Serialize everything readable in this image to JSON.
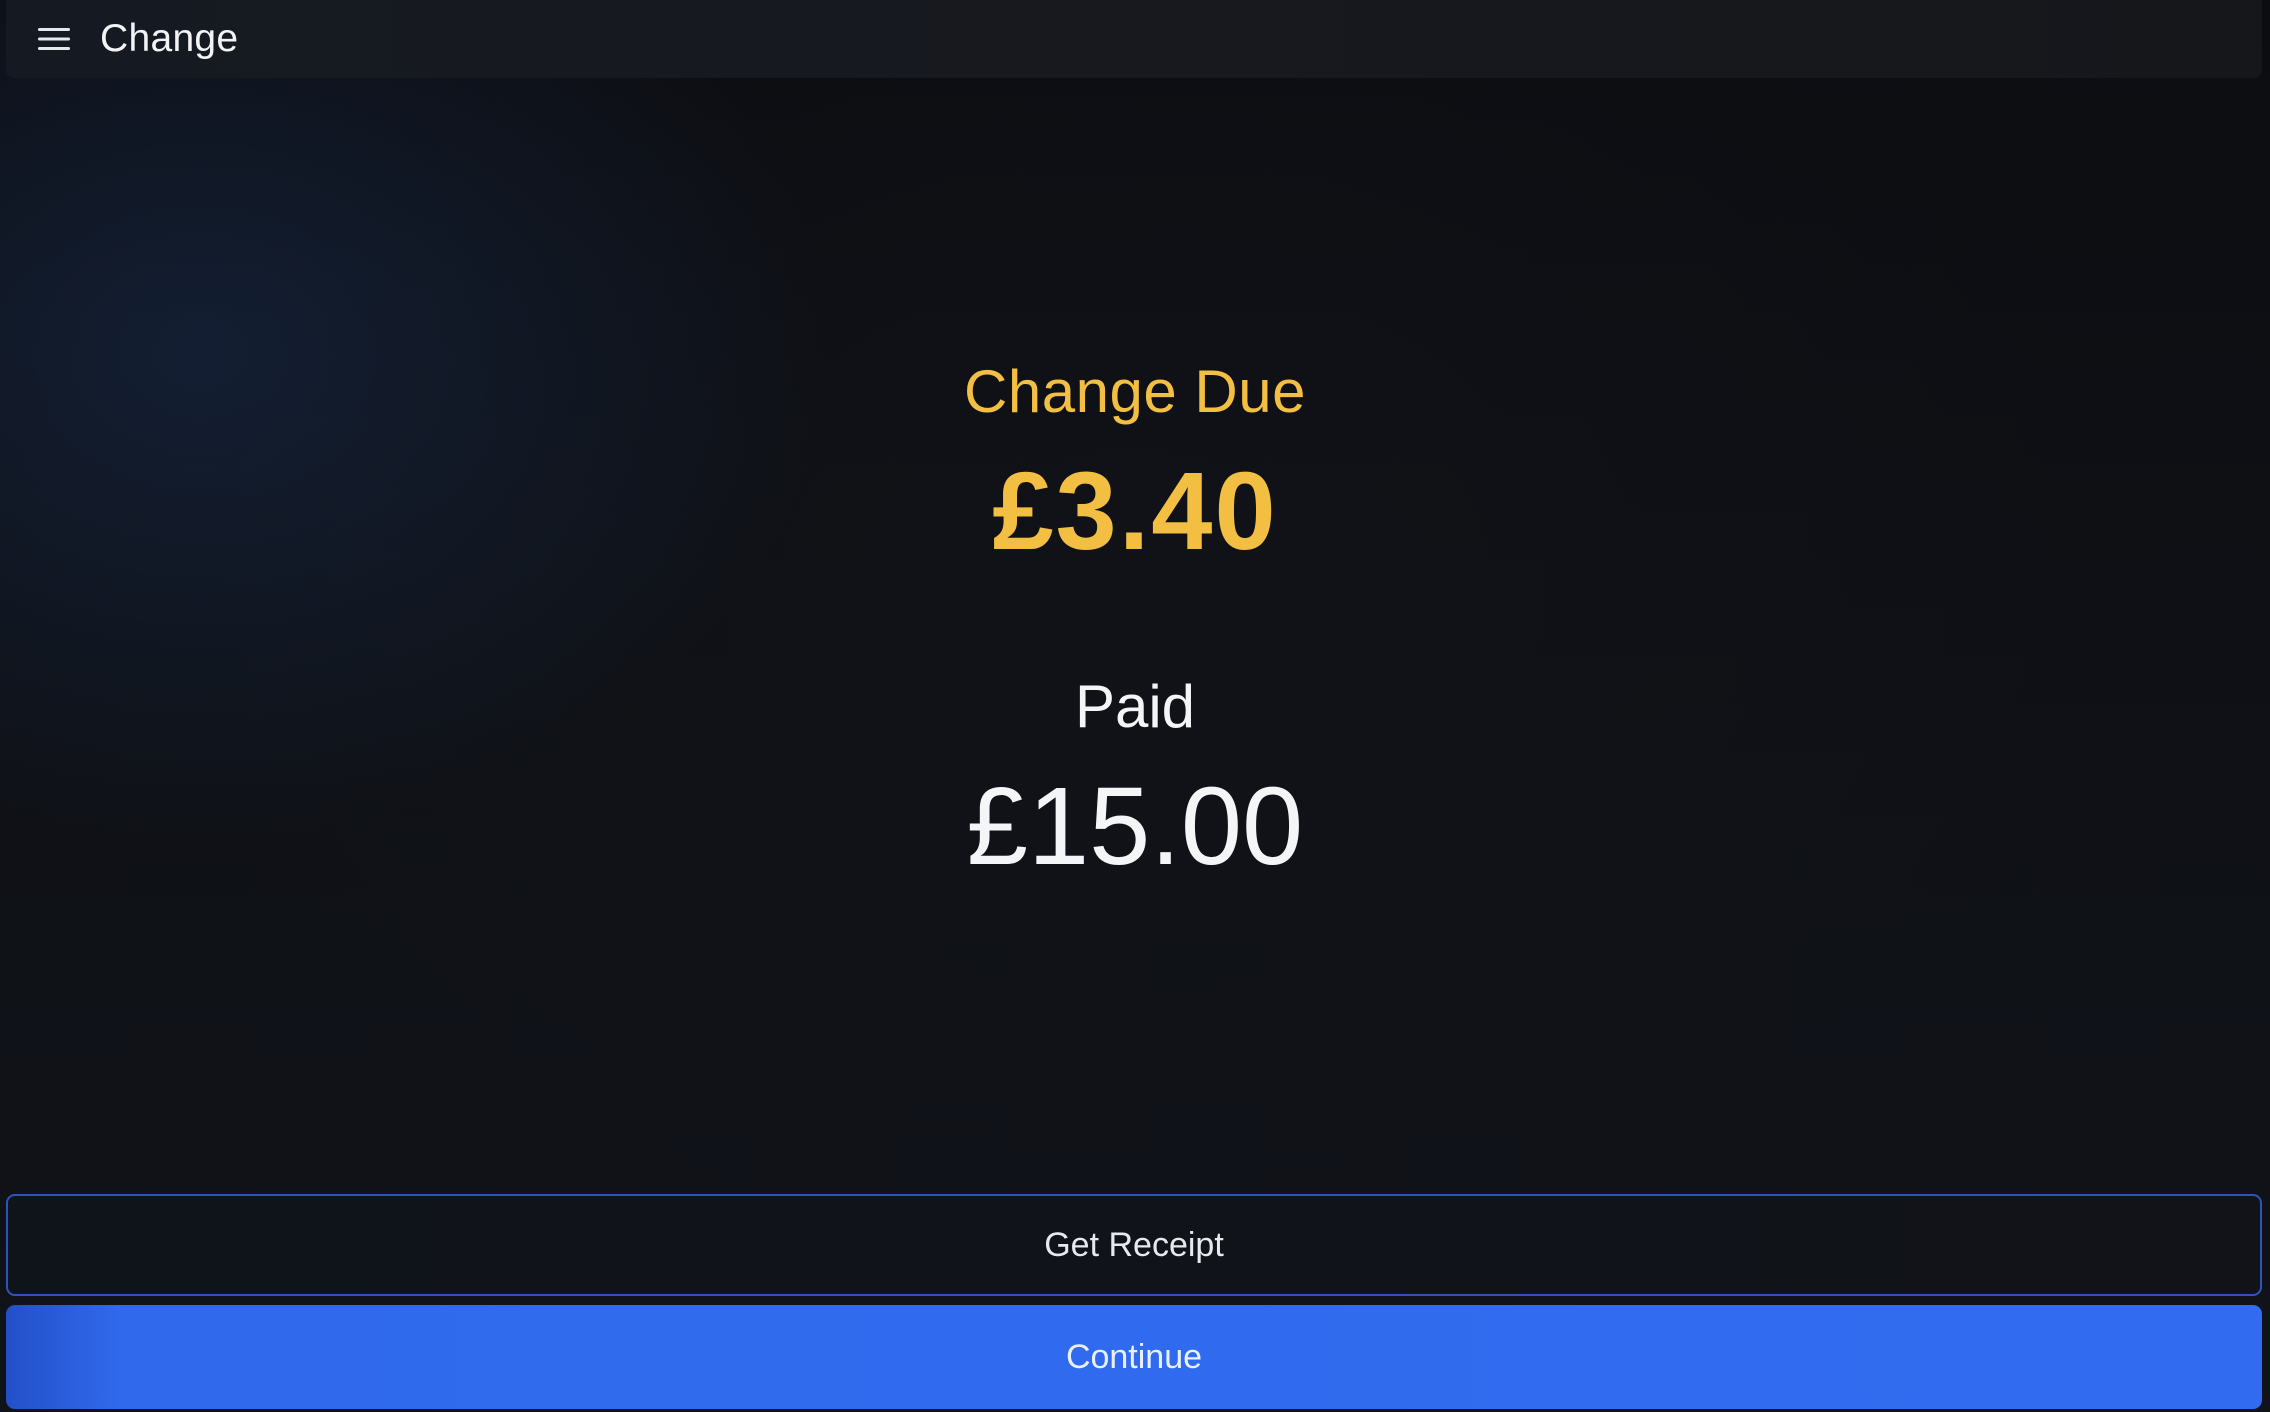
{
  "header": {
    "title": "Change",
    "menu_icon": "hamburger-menu-icon"
  },
  "summary": {
    "change_due_label": "Change Due",
    "change_due_amount": "£3.40",
    "paid_label": "Paid",
    "paid_amount": "£15.00"
  },
  "actions": {
    "receipt_label": "Get Receipt",
    "continue_label": "Continue"
  },
  "colors": {
    "accent_yellow": "#f2bf42",
    "primary_blue": "#316cf0",
    "background": "#0e0f13"
  }
}
